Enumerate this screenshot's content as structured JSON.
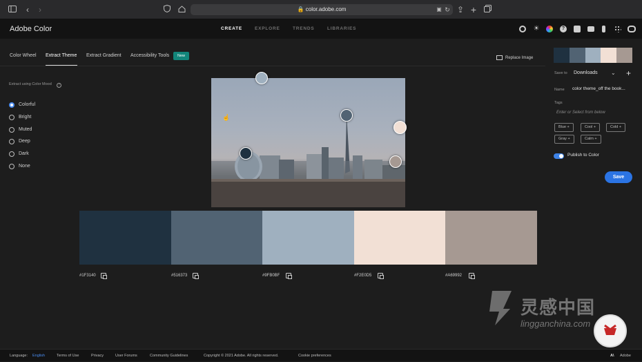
{
  "browser": {
    "url": "color.adobe.com",
    "icons": [
      "sidebar-icon",
      "back-icon",
      "forward-icon",
      "privacy-shield-icon",
      "home-icon",
      "lock-icon",
      "translate-icon",
      "reload-icon",
      "share-icon",
      "new-tab-plus-icon",
      "tabs-overview-icon"
    ]
  },
  "app": {
    "title": "Adobe Color",
    "nav": [
      {
        "label": "CREATE",
        "active": true
      },
      {
        "label": "EXPLORE",
        "active": false
      },
      {
        "label": "TRENDS",
        "active": false
      },
      {
        "label": "LIBRARIES",
        "active": false
      }
    ],
    "header_icons": [
      "theme-icon",
      "brightness-icon",
      "color-wheel-icon",
      "help-icon",
      "notifications-icon",
      "chat-icon",
      "profile-icon",
      "apps-grid-icon",
      "creative-cloud-icon"
    ]
  },
  "tabs": [
    {
      "label": "Color Wheel",
      "active": false
    },
    {
      "label": "Extract Theme",
      "active": true
    },
    {
      "label": "Extract Gradient",
      "active": false
    },
    {
      "label": "Accessibility Tools",
      "active": false
    }
  ],
  "new_badge": "New",
  "replace_image": "Replace Image",
  "mood": {
    "label": "Extract using Color Mood",
    "options": [
      "Colorful",
      "Bright",
      "Muted",
      "Deep",
      "Dark",
      "None"
    ],
    "selected": "Colorful"
  },
  "palette": [
    {
      "hex": "#1F3140",
      "color": "#1f3140"
    },
    {
      "hex": "#516373",
      "color": "#516373"
    },
    {
      "hex": "#9FB0BF",
      "color": "#9fb0bf"
    },
    {
      "hex": "#F2E0D5",
      "color": "#f2e0d5"
    },
    {
      "hex": "#A69992",
      "color": "#a69992"
    }
  ],
  "side": {
    "save_to_label": "Save to",
    "save_to_value": "Downloads",
    "name_label": "Name",
    "name_value": "color theme_off the book...",
    "tags_label": "Tags",
    "tags_placeholder": "Enter or Select from below",
    "tags": [
      "Blue",
      "Cool",
      "Cold",
      "Gray",
      "Calm"
    ],
    "publish_label": "Publish to Color",
    "publish_on": true,
    "save_button": "Save"
  },
  "watermark": {
    "cn": "灵感中国",
    "en": "lingganchina.com"
  },
  "footer": {
    "language_label": "Language:",
    "language_value": "English",
    "links": [
      "Terms of Use",
      "Privacy",
      "User Forums",
      "Community Guidelines"
    ],
    "copyright": "Copyright © 2021 Adobe. All rights reserved.",
    "cookie": "Cookie preferences",
    "brand": "Adobe"
  }
}
